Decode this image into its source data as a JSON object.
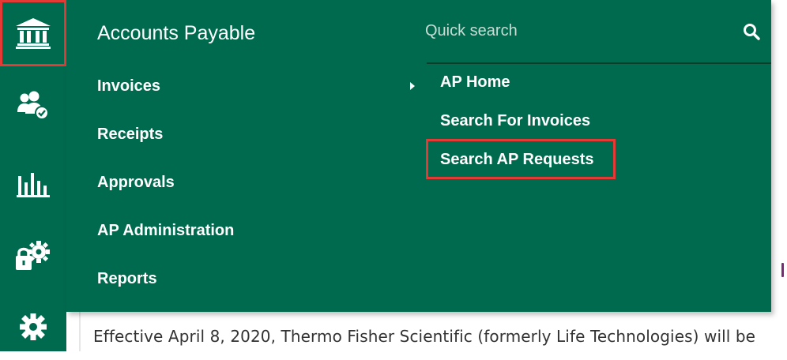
{
  "rail": {
    "items": [
      {
        "icon": "bank-icon",
        "selected": true
      },
      {
        "icon": "users-check-icon",
        "selected": false
      },
      {
        "icon": "bar-chart-icon",
        "selected": false
      },
      {
        "icon": "lock-gear-icon",
        "selected": false
      },
      {
        "icon": "gear-icon",
        "selected": false
      }
    ]
  },
  "flyout": {
    "title": "Accounts Payable",
    "menu": [
      "Invoices",
      "Receipts",
      "Approvals",
      "AP Administration",
      "Reports"
    ],
    "search": {
      "placeholder": "Quick search",
      "value": ""
    },
    "submenu": [
      "AP Home",
      "Search For Invoices",
      "Search AP Requests"
    ]
  },
  "page": {
    "notice": "Effective April 8, 2020, Thermo Fisher Scientific (formerly Life Technologies) will be"
  },
  "colors": {
    "brand_green": "#006a4e",
    "highlight_red": "#e53935"
  }
}
